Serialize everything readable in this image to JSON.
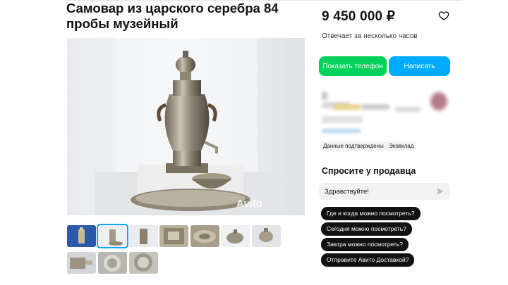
{
  "listing": {
    "title": "Самовар из царского серебра 84 пробы музейный",
    "watermark": "Avito",
    "thumbnail_count": 10
  },
  "price": {
    "value": "9 450 000 ₽",
    "reply_time": "Отвечает за несколько часов"
  },
  "actions": {
    "show_phone": "Показать телефон",
    "write": "Написать"
  },
  "seller": {
    "tags": [
      "Данные подтверждены",
      "Эковклад"
    ]
  },
  "ask_seller": {
    "title": "Спросите у продавца",
    "message_value": "Здравствуйте!",
    "quick_questions": [
      "Где и когда можно посмотреть?",
      "Сегодня можно посмотреть?",
      "Завтра можно посмотреть?",
      "Отправите Авито Доставкой?"
    ]
  },
  "colors": {
    "green": "#02d15c",
    "blue": "#00aaff",
    "dark": "#111111"
  },
  "icons": {
    "favorite": "heart-outline-icon",
    "send": "send-arrow-icon"
  }
}
